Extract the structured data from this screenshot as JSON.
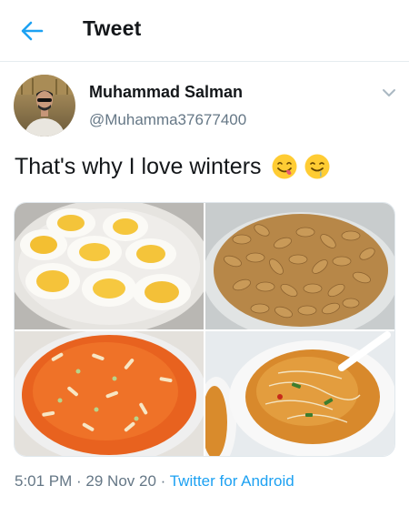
{
  "header": {
    "title": "Tweet",
    "back_icon": "arrow-left-icon",
    "accent_color": "#1da1f2"
  },
  "tweet": {
    "author": {
      "display_name": "Muhammad Salman",
      "handle": "@Muhamma37677400"
    },
    "text": "That's why I love winters",
    "emojis": [
      "yum-face-emoji",
      "drooling-face-emoji"
    ],
    "media": [
      {
        "name": "boiled-eggs-photo"
      },
      {
        "name": "peanuts-photo"
      },
      {
        "name": "gajar-halwa-photo"
      },
      {
        "name": "soup-photo"
      }
    ],
    "time": "5:01 PM",
    "sep1": " · ",
    "date": "29 Nov 20",
    "sep2": " · ",
    "source": "Twitter for Android"
  }
}
